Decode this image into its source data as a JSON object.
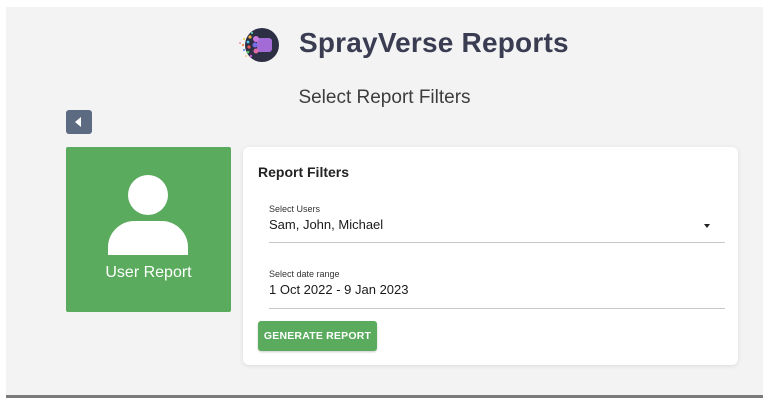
{
  "header": {
    "app_title": "SprayVerse Reports",
    "logo_icon": "sprayverse-logo-icon"
  },
  "page": {
    "title": "Select Report Filters"
  },
  "nav": {
    "back_icon": "chevron-left-icon"
  },
  "report_types": [
    {
      "label": "User Report",
      "icon": "user-icon",
      "color": "#5aab5d"
    }
  ],
  "filters": {
    "title": "Report Filters",
    "users": {
      "label": "Select Users",
      "value": "Sam, John, Michael"
    },
    "date_range": {
      "label": "Select date range",
      "value": "1 Oct 2022 - 9 Jan 2023"
    },
    "generate_label": "GENERATE REPORT"
  },
  "colors": {
    "accent_green": "#5aab5d",
    "back_button": "#5d6b82",
    "title_text": "#3a3d52",
    "background": "#f3f3f4"
  }
}
